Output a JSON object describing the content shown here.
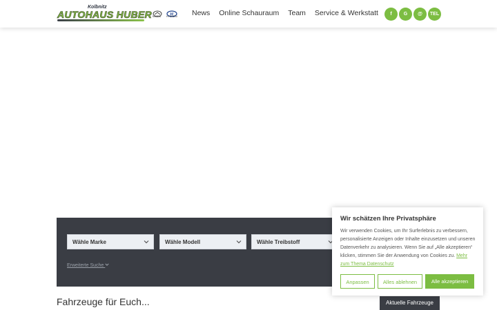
{
  "header": {
    "logo": {
      "small_text": "Kolbnitz",
      "main_text": "AUTOHAUS HUBER"
    },
    "brands": [
      {
        "name": "mazda-logo",
        "label": "MAZDA"
      },
      {
        "name": "hyundai-logo",
        "label": "HYUNDAI"
      }
    ],
    "nav": [
      "News",
      "Online Schauraum",
      "Team",
      "Service & Werkstatt"
    ],
    "socials": [
      {
        "icon": "facebook-icon",
        "label": "f"
      },
      {
        "icon": "google-icon",
        "label": "G"
      },
      {
        "icon": "email-icon",
        "label": "@"
      },
      {
        "icon": "phone-icon",
        "label": "TEL"
      }
    ]
  },
  "search": {
    "selects": [
      "Wähle Marke",
      "Wähle Modell",
      "Wähle Treibstoff"
    ],
    "extended_search": "Erweiterte Suche"
  },
  "main": {
    "section_title": "Fahrzeuge für Euch...",
    "current_vehicles_button": "Aktuelle Fahrzeuge"
  },
  "cookie": {
    "title": "Wir schätzen Ihre Privatsphäre",
    "text": "Wir verwenden Cookies, um Ihr Surferlebnis zu verbessern, personalisierte Anzeigen oder Inhalte einzusetzen und unseren Datenverkehr zu analysieren. Wenn Sie auf „Alle akzeptieren“ klicken, stimmen Sie der Anwendung von Cookies zu.",
    "link": "Mehr zum Thema Datenschutz",
    "buttons": {
      "customize": "Anpassen",
      "reject": "Alles ablehnen",
      "accept": "Alle akzeptieren"
    }
  },
  "colors": {
    "accent": "#7cbd42",
    "dark": "#3a3d44"
  }
}
